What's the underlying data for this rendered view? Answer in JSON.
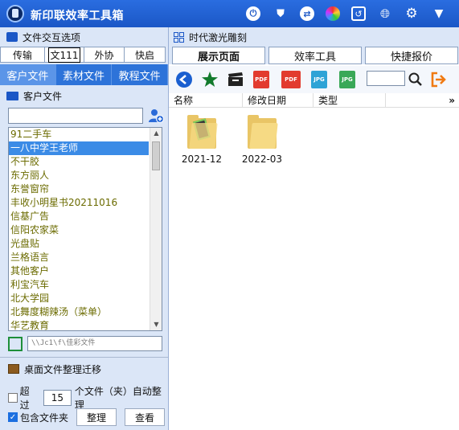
{
  "window": {
    "title": "新印联效率工具箱",
    "titlebar_icons": [
      "power-icon",
      "shield-icon",
      "share-icon",
      "color-wheel-icon",
      "link-icon",
      "globe-icon",
      "settings-icon",
      "minimize-icon"
    ]
  },
  "left": {
    "header": "文件交互选项",
    "tabs": [
      "传输",
      "文111",
      "外协",
      "快启"
    ],
    "subtabs": [
      "客户文件",
      "素材文件",
      "教程文件"
    ],
    "customer_files_label": "客户文件",
    "search_placeholder": "",
    "customers": [
      "91二手车",
      "一八中学王老师",
      "不干胶",
      "东方丽人",
      "东誉窗帘",
      "丰收小明星书20211016",
      "信基广告",
      "信阳农家菜",
      "光盘贴",
      "兰格语言",
      "其他客户",
      "利宝汽车",
      "北大学园",
      "北舞度糊辣汤（菜单）",
      "华艺教育"
    ],
    "selected_index": 1,
    "path": "\\\\Jc1\\f\\佳彩文件",
    "organize": {
      "header": "桌面文件整理迁移",
      "exceed_label": "超过",
      "exceed_value": "15",
      "exceed_suffix": "个文件（夹）自动整理",
      "exceed_checked": false,
      "include_folders_label": "包含文件夹",
      "include_folders_checked": true,
      "organize_button": "整理",
      "view_button": "查看"
    }
  },
  "right": {
    "header": "时代激光雕刻",
    "tabs": [
      "展示页面",
      "效率工具",
      "快捷报价"
    ],
    "active_tab": 0,
    "columns": [
      "名称",
      "修改日期",
      "类型",
      "»"
    ],
    "search_value": "",
    "files": [
      {
        "name": "2021-12",
        "type": "folder-with-file"
      },
      {
        "name": "2022-03",
        "type": "folder"
      }
    ]
  },
  "colors": {
    "titlebar": "#1b57c6",
    "accent": "#2d73d9",
    "selection": "#3b8be6",
    "customer_text": "#6b6b00"
  }
}
